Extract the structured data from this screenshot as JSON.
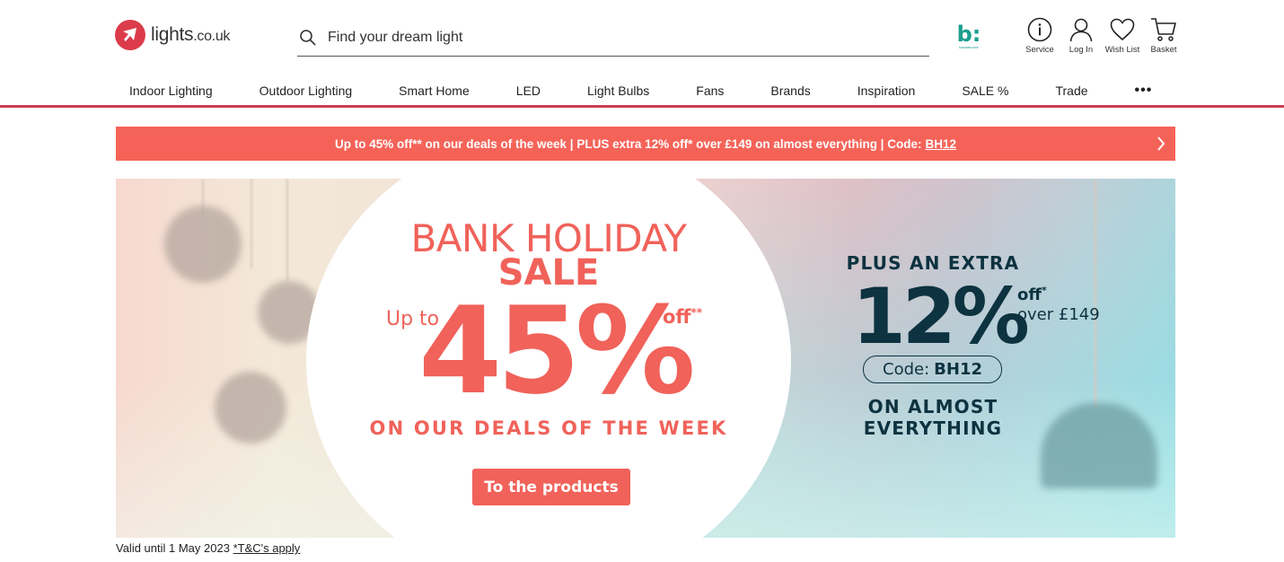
{
  "header": {
    "logo_text": "lights",
    "logo_tld": ".co.uk",
    "search_placeholder": "Find your dream light",
    "bazaar_letter": "b:",
    "bazaar_sub": "bazaarvoice",
    "icons": [
      {
        "label": "Service",
        "icon": "info-icon"
      },
      {
        "label": "Log In",
        "icon": "user-icon"
      },
      {
        "label": "Wish List",
        "icon": "heart-icon"
      },
      {
        "label": "Basket",
        "icon": "cart-icon"
      }
    ]
  },
  "nav": {
    "items": [
      "Indoor Lighting",
      "Outdoor Lighting",
      "Smart Home",
      "LED",
      "Light Bulbs",
      "Fans",
      "Brands",
      "Inspiration",
      "SALE %",
      "Trade"
    ],
    "more": "•••"
  },
  "promo": {
    "text": "Up to 45% off** on our deals of the week | PLUS extra 12% off* over £149 on almost everything | Code:",
    "code": "BH12"
  },
  "hero": {
    "line1": "BANK HOLIDAY",
    "line2": "SALE",
    "upto": "Up to",
    "pct": "45%",
    "off": "off",
    "off_sup": "**",
    "deals": "ON OUR DEALS OF THE WEEK",
    "cta": "To the products",
    "plus": "PLUS AN EXTRA",
    "extra_pct": "12%",
    "extra_off": "off",
    "extra_off_sup": "*",
    "over": "over £149",
    "code_label": "Code:",
    "code": "BH12",
    "almost_1": "ON ALMOST",
    "almost_2": "EVERYTHING"
  },
  "footer_note": {
    "valid": "Valid until 1 May 2023 ",
    "tc": "*T&C's apply"
  },
  "colors": {
    "brand_red": "#dc3b4a",
    "promo_bg": "#f56358",
    "hero_coral": "#f0625a",
    "hero_navy": "#0d3240"
  }
}
